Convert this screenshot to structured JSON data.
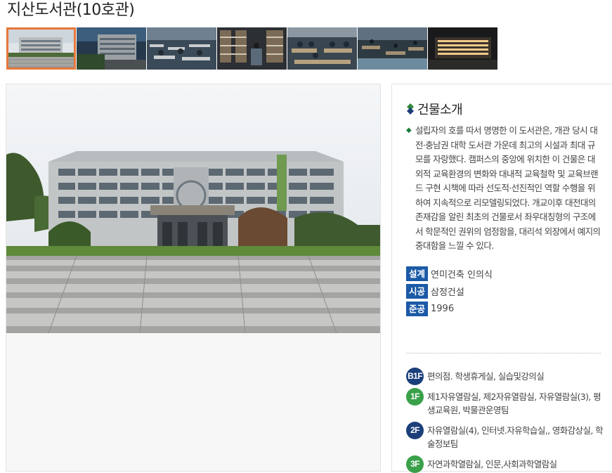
{
  "page": {
    "title": "지산도서관(10호관)"
  },
  "gallery": {
    "thumbnails": [
      {
        "label": "building-front",
        "active": true
      },
      {
        "label": "building-side",
        "active": false
      },
      {
        "label": "reading-room-1",
        "active": false
      },
      {
        "label": "bookshelves",
        "active": false
      },
      {
        "label": "study-hall",
        "active": false
      },
      {
        "label": "reading-room-2",
        "active": false
      },
      {
        "label": "building-night",
        "active": false
      }
    ],
    "colors": {
      "active_border": "#e8773a"
    }
  },
  "info": {
    "heading": "건물소개",
    "description": "설립자의 호를 따서 명명한 이 도서관은, 개관 당시 대전·충남권 대학 도서관 가운데 최고의 시설과 최대 규모를 자랑했다. 캠퍼스의 중앙에 위치한 이 건물은 대외적 교육환경의 변화와 대내적 교육철학 및 교육브랜드 구현 시책에 따라 선도적·선진적인 역할 수행을 위하여 지속적으로 리모델링되었다. 개교이후 대전대의 존재감을 알린 최초의 건물로서 좌우대칭형의 구조에서 학문적인 권위의 엄정함을, 대리석 외장에서 예지의 중대함을 느낄 수 있다.",
    "specs": [
      {
        "label": "설계",
        "value": "연미건축 인의식"
      },
      {
        "label": "시공",
        "value": "삼정건설"
      },
      {
        "label": "준공",
        "value": "1996"
      }
    ],
    "floors": [
      {
        "badge": "B1F",
        "color": "#1b3f7a",
        "text": "편의점. 학생휴게실, 실습및강의실"
      },
      {
        "badge": "1F",
        "color": "#3aa04a",
        "text": "제1자유열람실, 제2자유열람실, 자유열람실(3), 평생교육원, 박물관운영팀"
      },
      {
        "badge": "2F",
        "color": "#1b3f7a",
        "text": "자유열람실(4), 인터넷.자유학습실,, 영화감상실, 학술정보팀"
      },
      {
        "badge": "3F",
        "color": "#3aa04a",
        "text": "자연과학열람실, 인문,사회과학열람실"
      }
    ],
    "colors": {
      "badge": "#1b5aa6",
      "bullet": "#1a7a3a"
    }
  }
}
